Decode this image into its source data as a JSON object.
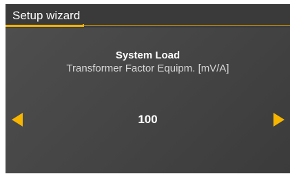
{
  "header": {
    "title": "Setup wizard",
    "progress_fraction": 0.27,
    "accent_color": "#f5b400"
  },
  "parameter": {
    "title": "System Load",
    "subtitle": "Transformer Factor Equipm. [mV/A]",
    "value": "100"
  },
  "icons": {
    "decrease": "arrow-left-icon",
    "increase": "arrow-right-icon"
  }
}
